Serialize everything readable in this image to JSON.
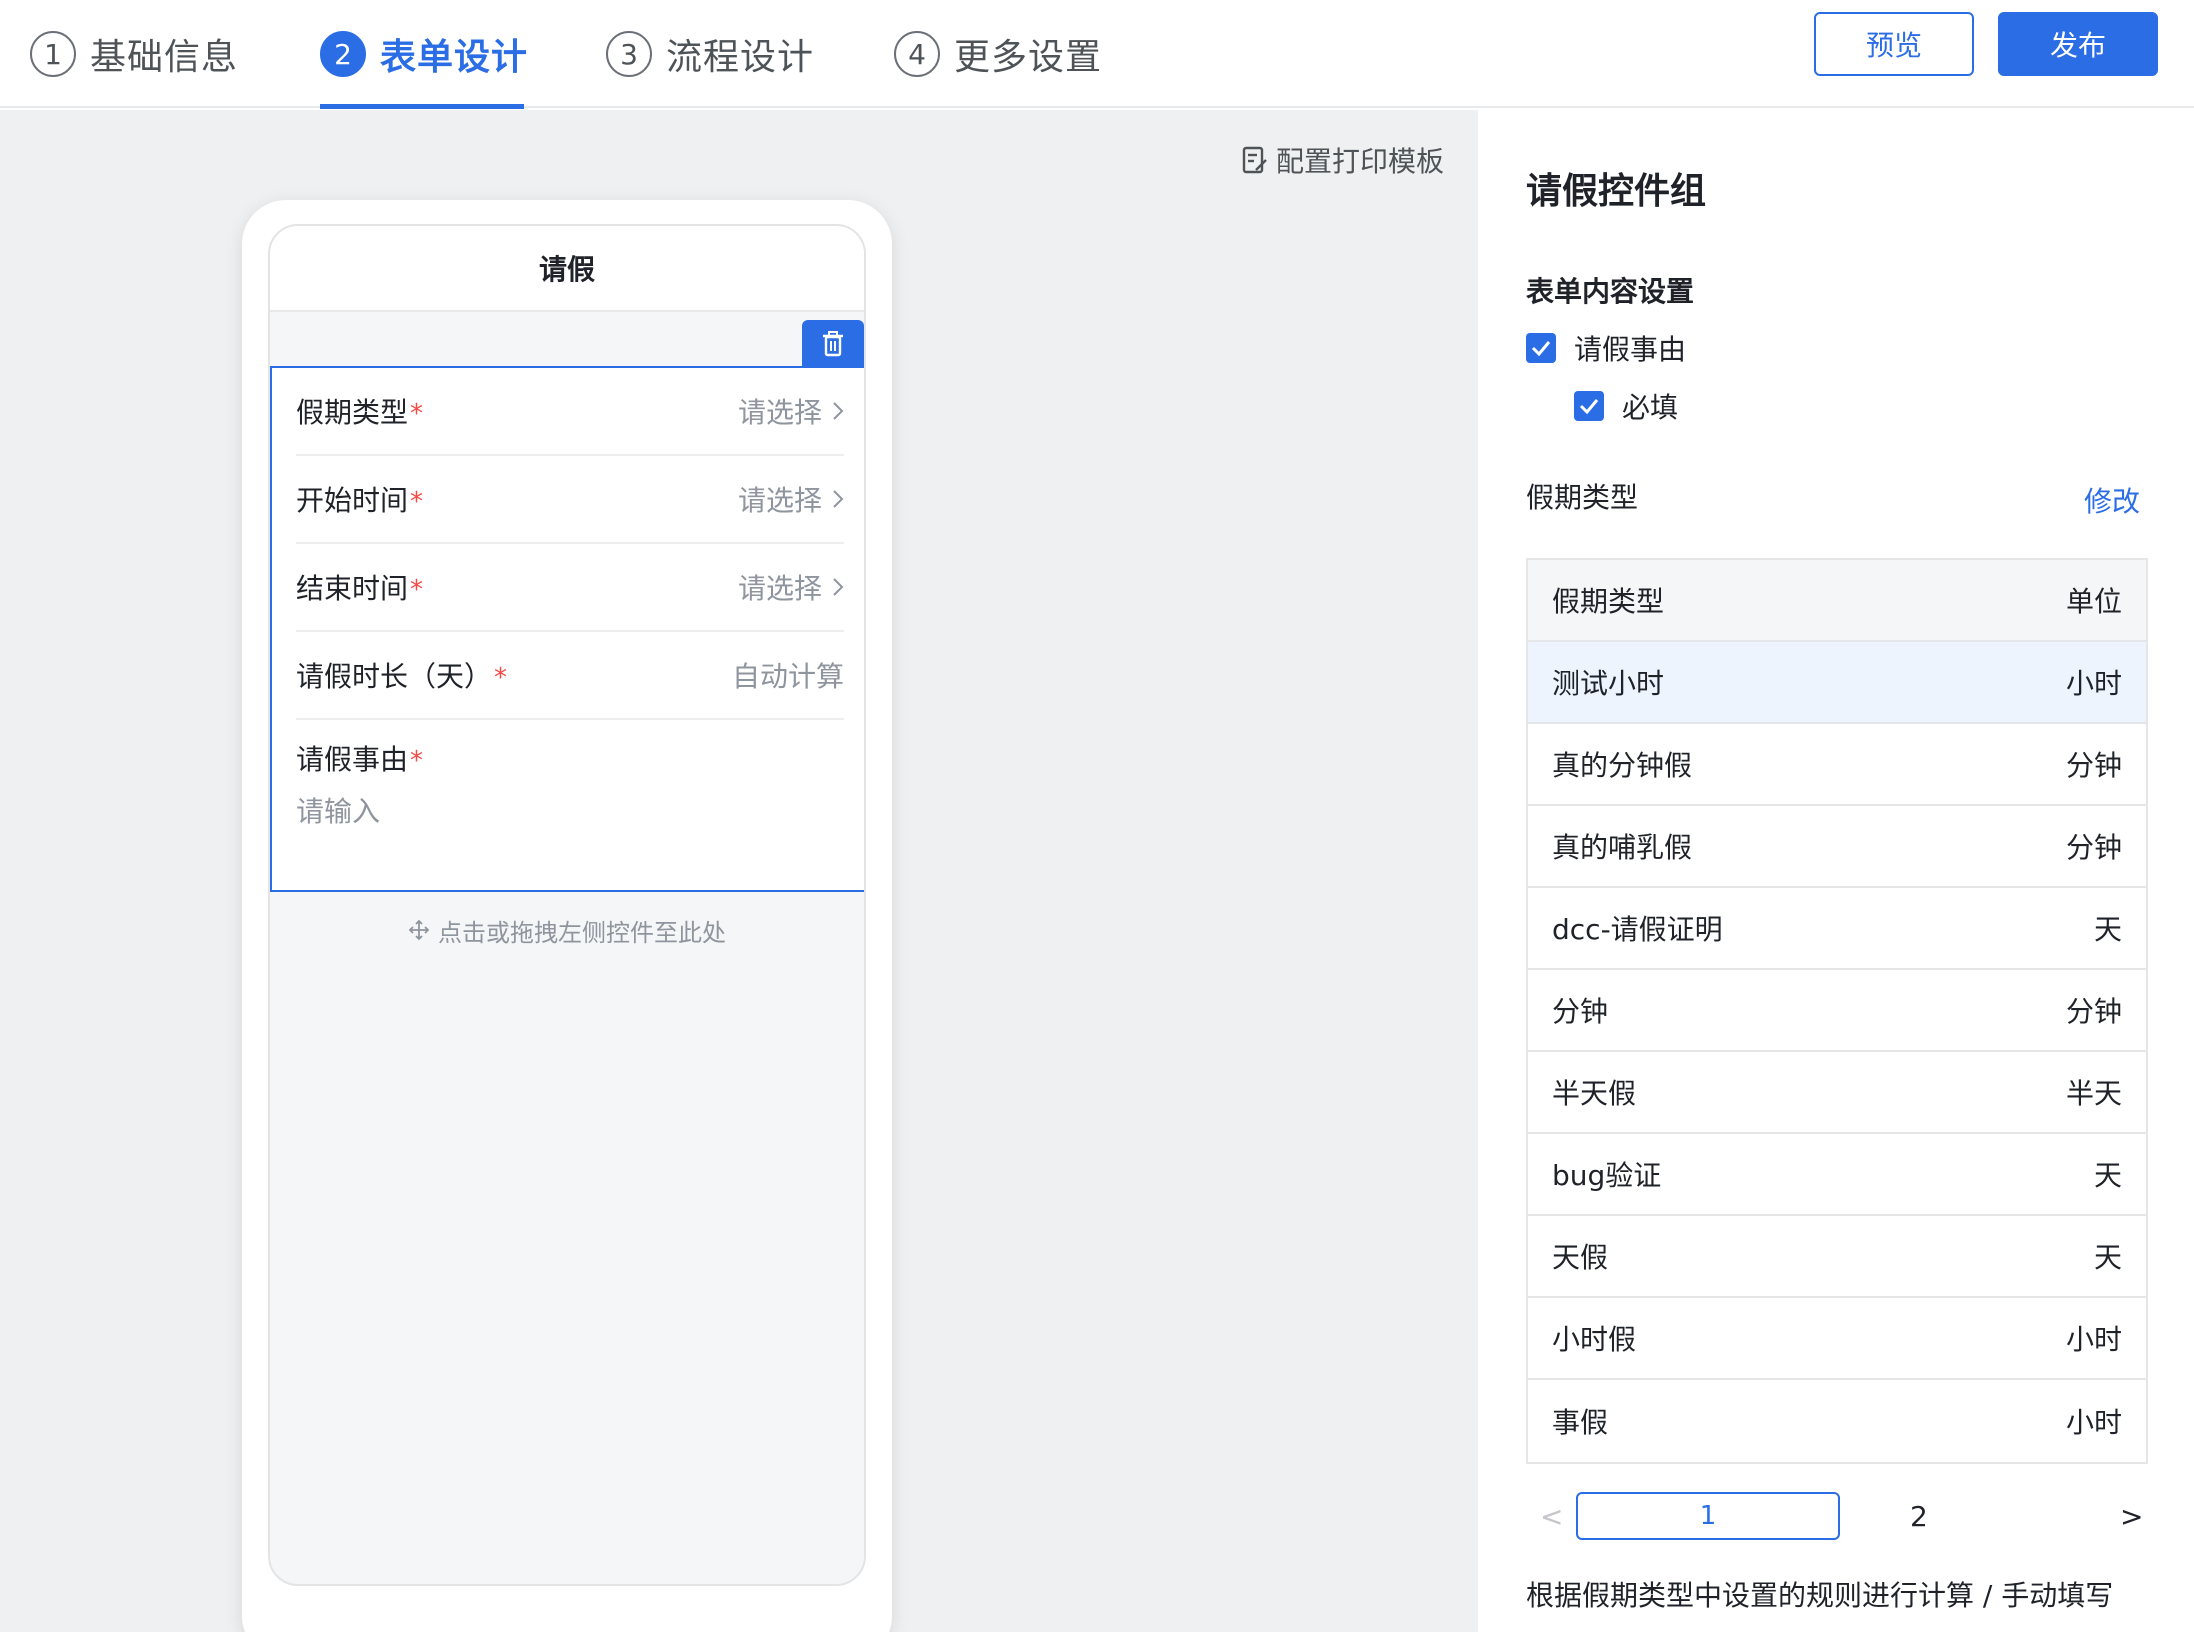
{
  "header": {
    "steps": [
      {
        "num": "1",
        "label": "基础信息"
      },
      {
        "num": "2",
        "label": "表单设计"
      },
      {
        "num": "3",
        "label": "流程设计"
      },
      {
        "num": "4",
        "label": "更多设置"
      }
    ],
    "active_step": 2,
    "preview_label": "预览",
    "publish_label": "发布"
  },
  "canvas": {
    "print_template_label": "配置打印模板",
    "form_title": "请假",
    "fields": [
      {
        "label": "假期类型",
        "required": "*",
        "value": "请选择"
      },
      {
        "label": "开始时间",
        "required": "*",
        "value": "请选择"
      },
      {
        "label": "结束时间",
        "required": "*",
        "value": "请选择"
      },
      {
        "label": "请假时长（天）",
        "required": "*",
        "value": "自动计算"
      }
    ],
    "reason": {
      "label": "请假事由",
      "required": "*",
      "placeholder": "请输入"
    },
    "drop_hint": "点击或拖拽左侧控件至此处"
  },
  "panel": {
    "title": "请假控件组",
    "content_settings": "表单内容设置",
    "checkbox_reason": "请假事由",
    "checkbox_required": "必填",
    "leave_type_label": "假期类型",
    "edit_label": "修改",
    "table": {
      "headers": [
        "假期类型",
        "单位"
      ],
      "rows": [
        [
          "测试小时",
          "小时"
        ],
        [
          "真的分钟假",
          "分钟"
        ],
        [
          "真的哺乳假",
          "分钟"
        ],
        [
          "dcc-请假证明",
          "天"
        ],
        [
          "分钟",
          "分钟"
        ],
        [
          "半天假",
          "半天"
        ],
        [
          "bug验证",
          "天"
        ],
        [
          "天假",
          "天"
        ],
        [
          "小时假",
          "小时"
        ],
        [
          "事假",
          "小时"
        ]
      ]
    },
    "pagination": {
      "prev": "<",
      "current": "1",
      "page2": "2",
      "next": ">"
    },
    "footer_note": "根据假期类型中设置的规则进行计算 / 手动填写"
  },
  "colors": {
    "accent": "#2b6de5",
    "required": "#f54a45",
    "canvas_bg": "#eff0f1"
  }
}
